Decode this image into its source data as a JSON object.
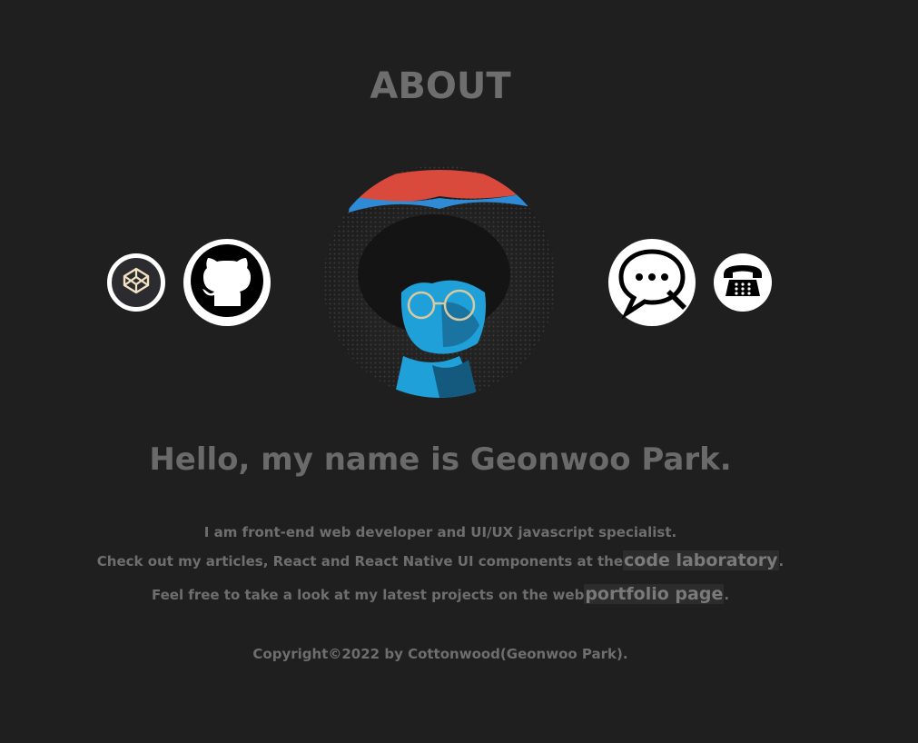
{
  "about": {
    "title": "ABOUT"
  },
  "links": {
    "codepen_icon": "codepen-icon",
    "github_icon": "github-icon",
    "chat_icon": "chat-icon",
    "phone_icon": "phone-icon"
  },
  "profile": {
    "greeting": "Hello, my name is Geonwoo Park.",
    "line1": "I am front-end web developer and UI/UX javascript specialist.",
    "line2_prefix": "Check out my articles, React and React Native UI components at the",
    "line2_link": "code laboratory",
    "line2_suffix": ".",
    "line3_prefix": "Feel free to take a look at my latest projects on the web",
    "line3_link": "portfolio page",
    "line3_suffix": "."
  },
  "footer": {
    "copyright": "Copyright©2022 by Cottonwood(Geonwoo Park)."
  },
  "colors": {
    "background": "#1f1f1f",
    "text": "#6e6e6e",
    "avatar_blue": "#1fa0d8"
  }
}
